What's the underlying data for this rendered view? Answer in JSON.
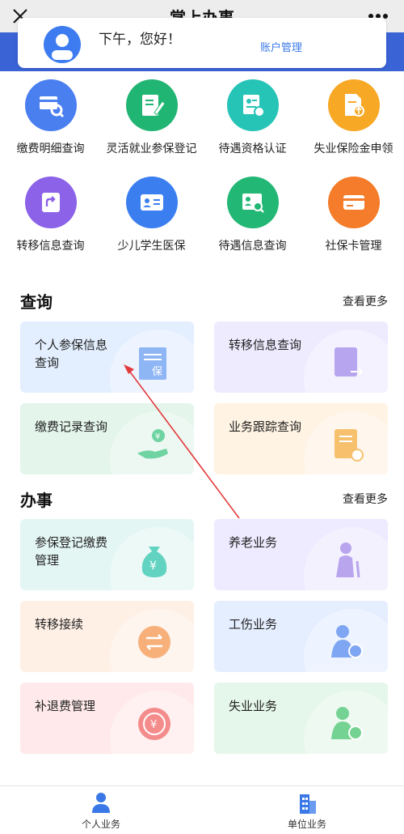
{
  "titlebar": {
    "title": "掌上办事",
    "close_icon": "close-icon",
    "more_icon": "more-icon"
  },
  "account": {
    "greeting": "下午，您好！",
    "manage_link": "账户管理"
  },
  "services": [
    {
      "label": "缴费明细查询",
      "color": "#4a7ff0",
      "icon": "card-search-icon"
    },
    {
      "label": "灵活就业参保登记",
      "color": "#21b573",
      "icon": "form-edit-icon"
    },
    {
      "label": "待遇资格认证",
      "color": "#26c4b6",
      "icon": "id-certify-icon"
    },
    {
      "label": "失业保险金申领",
      "color": "#f7a825",
      "icon": "doc-upload-icon"
    },
    {
      "label": "转移信息查询",
      "color": "#8b62e8",
      "icon": "transfer-icon"
    },
    {
      "label": "少儿学生医保",
      "color": "#3b7ef0",
      "icon": "id-card-icon"
    },
    {
      "label": "待遇信息查询",
      "color": "#22b774",
      "icon": "id-search-icon"
    },
    {
      "label": "社保卡管理",
      "color": "#f57c2a",
      "icon": "bank-card-icon"
    }
  ],
  "query_section": {
    "title": "查询",
    "more": "查看更多"
  },
  "query_cards": [
    {
      "line1": "个人参保信息",
      "line2": "查询",
      "bg": "#e3efff",
      "accent": "#8fb6f4"
    },
    {
      "line1": "转移信息查询",
      "line2": "",
      "bg": "#eeebff",
      "accent": "#b7a6ef"
    },
    {
      "line1": "缴费记录查询",
      "line2": "",
      "bg": "#e4f5ec",
      "accent": "#6fd3a2"
    },
    {
      "line1": "业务跟踪查询",
      "line2": "",
      "bg": "#fff3e3",
      "accent": "#f6c06c"
    }
  ],
  "work_section": {
    "title": "办事",
    "more": "查看更多"
  },
  "work_cards": [
    {
      "line1": "参保登记缴费",
      "line2": "管理",
      "bg": "#e3f6f3",
      "accent": "#62d3c1"
    },
    {
      "line1": "养老业务",
      "line2": "",
      "bg": "#eeeaff",
      "accent": "#b9a4ee"
    },
    {
      "line1": "转移接续",
      "line2": "",
      "bg": "#fff0e6",
      "accent": "#f7b07a"
    },
    {
      "line1": "工伤业务",
      "line2": "",
      "bg": "#e5eeff",
      "accent": "#7fa6f2"
    },
    {
      "line1": "补退费管理",
      "line2": "",
      "bg": "#ffe9ea",
      "accent": "#f58c8c"
    },
    {
      "line1": "失业业务",
      "line2": "",
      "bg": "#e5f6ea",
      "accent": "#74d392"
    }
  ],
  "bottomnav": [
    {
      "label": "个人业务",
      "icon": "person-icon",
      "color": "#3b78e7"
    },
    {
      "label": "单位业务",
      "icon": "building-icon",
      "color": "#3b78e7"
    }
  ]
}
